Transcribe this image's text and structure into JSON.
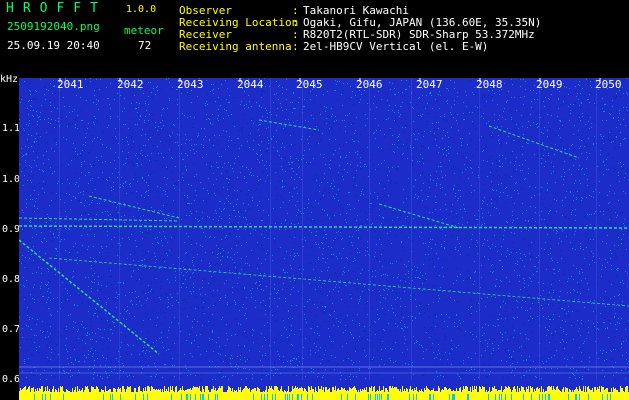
{
  "header": {
    "logo": "HROFFT",
    "version": "1.0.0",
    "filename": "2509192040.png",
    "meteor_label": "meteor",
    "timestamp": "25.09.19 20:40",
    "meteor_count": "72"
  },
  "info": [
    {
      "label": "Observer",
      "value": "Takanori Kawachi"
    },
    {
      "label": "Receiving Location",
      "value": "Ogaki, Gifu, JAPAN (136.60E, 35.35N)"
    },
    {
      "label": "Receiver",
      "value": "R820T2(RTL-SDR) SDR-Sharp 53.372MHz"
    },
    {
      "label": "Receiving antenna",
      "value": "2el-HB9CV Vertical (el. E-W)"
    }
  ],
  "axes": {
    "y_unit": "kHz",
    "y_ticks": [
      "1.1",
      "1.0",
      "0.9",
      "0.8",
      "0.7",
      "0.6"
    ],
    "x_ticks": [
      "2041",
      "2042",
      "2043",
      "2044",
      "2045",
      "2046",
      "2047",
      "2048",
      "2049",
      "2050"
    ]
  },
  "colors": {
    "background": "#1b2cc9",
    "noise": "#00c8ff",
    "trace": "#33ff99",
    "echo": "#ffff00"
  }
}
